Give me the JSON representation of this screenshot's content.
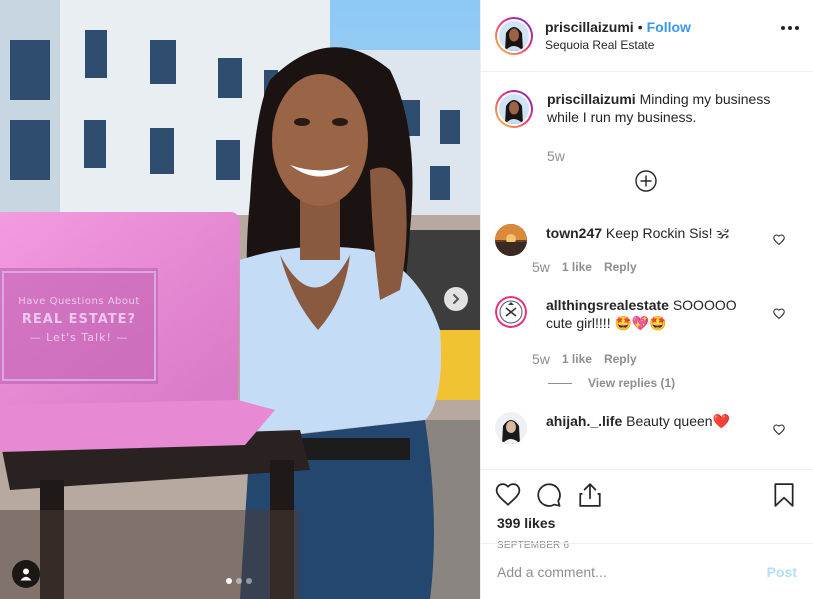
{
  "header": {
    "username": "priscillaizumi",
    "separator": "•",
    "follow_label": "Follow",
    "location": "Sequoia Real Estate"
  },
  "caption": {
    "username": "priscillaizumi",
    "text": "Minding my business while I run my business.",
    "time": "5w"
  },
  "media": {
    "laptop_sticker": {
      "line1": "Have Questions About",
      "line2": "REAL ESTATE?",
      "line3": "— Let's Talk! —"
    },
    "carousel_dots": 3,
    "active_dot": 1
  },
  "comments": [
    {
      "username": "town247",
      "text": "Keep Rockin Sis! 🕉",
      "time": "5w",
      "likes": "1 like",
      "reply": "Reply"
    },
    {
      "username": "allthingsrealestate",
      "text": "SOOOOO cute girl!!!! 🤩💖🤩",
      "time": "5w",
      "likes": "1 like",
      "reply": "Reply",
      "view_replies": "View replies (1)"
    },
    {
      "username": "ahijah._.life",
      "text": "Beauty queen❤️"
    }
  ],
  "actions": {
    "likes": "399 likes",
    "date": "SEPTEMBER 6"
  },
  "add_comment": {
    "placeholder": "Add a comment...",
    "post_label": "Post"
  },
  "colors": {
    "link_blue": "#3897f0",
    "post_disabled": "#b2dffc",
    "secondary_text": "#8e8e8e",
    "laptop_pink": "#e98fd6"
  },
  "icons": [
    "plus-circle-icon",
    "heart-icon",
    "comment-icon",
    "share-icon",
    "bookmark-icon",
    "chevron-right-icon",
    "user-tag-icon",
    "more-icon"
  ]
}
